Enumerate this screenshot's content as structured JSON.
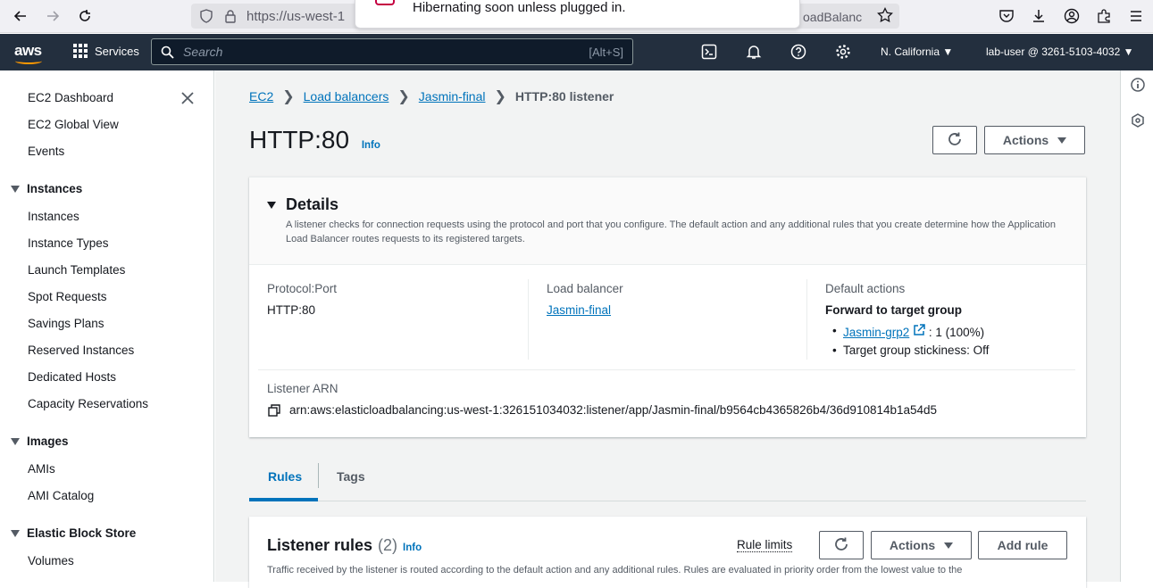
{
  "browser": {
    "url": "https://us-west-1",
    "url_tail": "oadBalanc",
    "notification": "Hibernating soon unless plugged in."
  },
  "topnav": {
    "logo": "aws",
    "services_label": "Services",
    "search_placeholder": "Search",
    "search_shortcut": "[Alt+S]",
    "region": "N. California",
    "account": "lab-user @ 3261-5103-4032"
  },
  "sidebar": {
    "top_items": [
      "EC2 Dashboard",
      "EC2 Global View",
      "Events"
    ],
    "instances_header": "Instances",
    "instances_items": [
      "Instances",
      "Instance Types",
      "Launch Templates",
      "Spot Requests",
      "Savings Plans",
      "Reserved Instances",
      "Dedicated Hosts",
      "Capacity Reservations"
    ],
    "images_header": "Images",
    "images_items": [
      "AMIs",
      "AMI Catalog"
    ],
    "ebs_header": "Elastic Block Store",
    "ebs_items": [
      "Volumes"
    ]
  },
  "breadcrumb": {
    "items": [
      "EC2",
      "Load balancers",
      "Jasmin-final"
    ],
    "current": "HTTP:80 listener"
  },
  "page": {
    "title": "HTTP:80",
    "info": "Info",
    "actions_label": "Actions"
  },
  "details": {
    "title": "Details",
    "description": "A listener checks for connection requests using the protocol and port that you configure. The default action and any additional rules that you create determine how the Application Load Balancer routes requests to its registered targets.",
    "protocol_label": "Protocol:Port",
    "protocol_value": "HTTP:80",
    "lb_label": "Load balancer",
    "lb_value": "Jasmin-final",
    "default_label": "Default actions",
    "default_heading": "Forward to target group",
    "target_group": "Jasmin-grp2",
    "target_weight": ": 1 (100%)",
    "stickiness": "Target group stickiness: Off",
    "arn_label": "Listener ARN",
    "arn_value": "arn:aws:elasticloadbalancing:us-west-1:326151034032:listener/app/Jasmin-final/b9564cb4365826b4/36d910814b1a54d5"
  },
  "tabs": [
    "Rules",
    "Tags"
  ],
  "rules": {
    "title": "Listener rules",
    "count": "(2)",
    "info": "Info",
    "rule_limits": "Rule limits",
    "actions_label": "Actions",
    "add_rule": "Add rule",
    "description": "Traffic received by the listener is routed according to the default action and any additional rules. Rules are evaluated in priority order from the lowest value to the"
  }
}
